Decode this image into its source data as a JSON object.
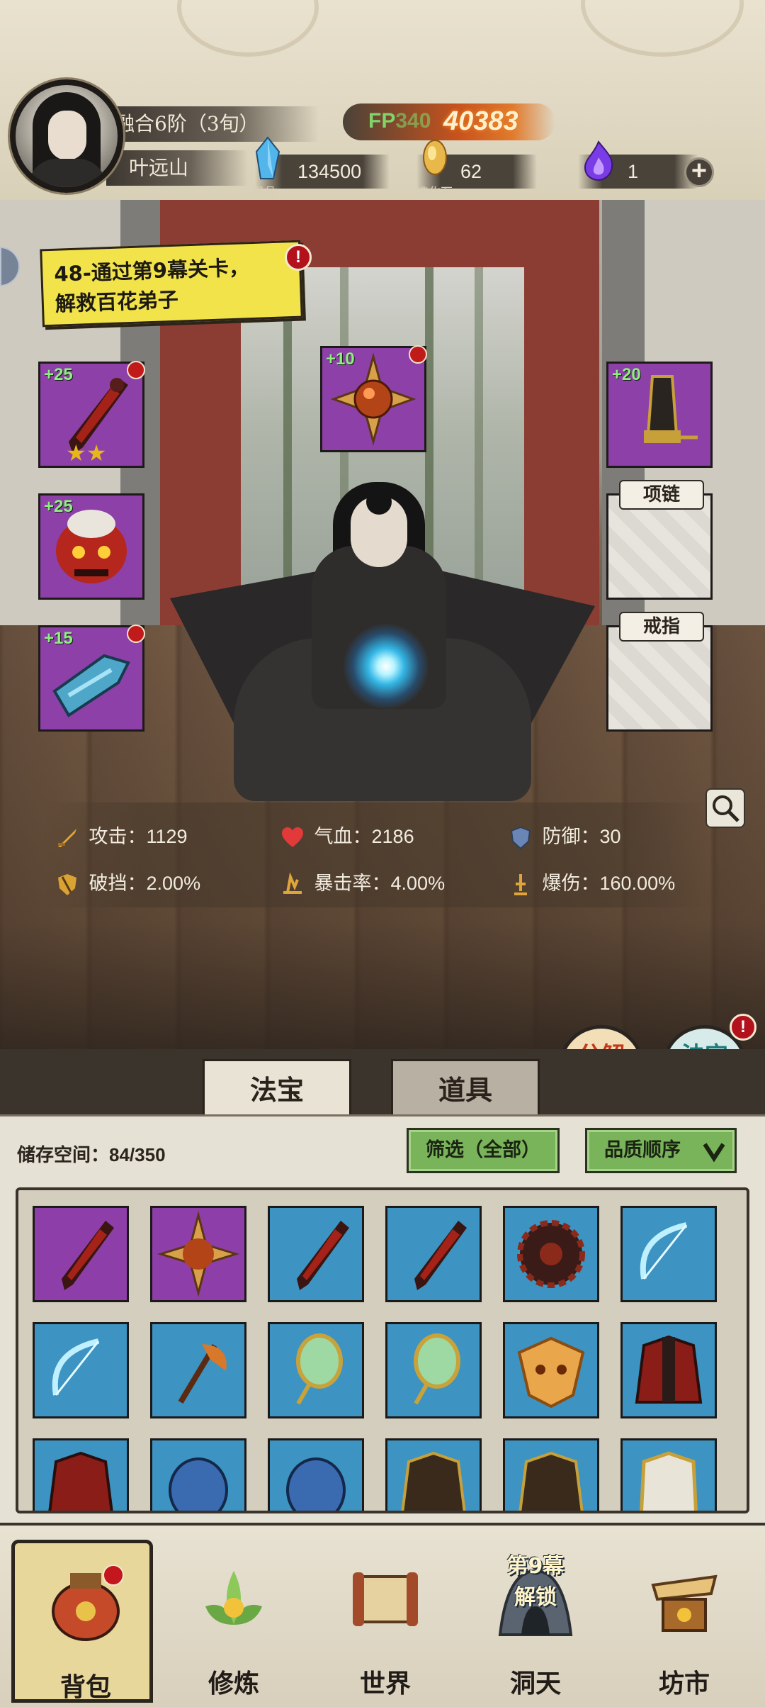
{
  "player": {
    "realm": "融合6阶（3旬）",
    "name": "叶远山",
    "power_label": "FP",
    "power_label_tail": "340",
    "power_value": "40383"
  },
  "resources": [
    {
      "name": "灵晶",
      "value": "134500",
      "icon": "blue-crystal-icon"
    },
    {
      "name": "造化石",
      "value": "62",
      "icon": "golden-stone-icon"
    },
    {
      "name": "",
      "value": "1",
      "icon": "purple-flame-icon"
    }
  ],
  "quest": {
    "line1": "48-通过第9幕关卡，",
    "line2": "解救百花弟子",
    "alert": "!"
  },
  "equipment": {
    "weapon": {
      "level": "+25",
      "stars": "★★"
    },
    "head": {
      "level": "+10"
    },
    "belt": {
      "level": "+20"
    },
    "armor": {
      "level": "+25"
    },
    "boots": {
      "level": "+15"
    },
    "necklace": {
      "label": "项链"
    },
    "ring": {
      "label": "戒指"
    }
  },
  "stats": {
    "attack": "攻击：1129",
    "hp": "气血：2186",
    "defense": "防御：30",
    "pierce": "破挡：2.00%",
    "crit_rate": "暴击率：4.00%",
    "crit_dmg": "爆伤：160.00%"
  },
  "actions": {
    "decompose": [
      "分解",
      "再造"
    ],
    "synthesize": [
      "法宝",
      "合成"
    ],
    "alert": "!"
  },
  "tabs": {
    "treasure": "法宝",
    "items": "道具"
  },
  "inventory": {
    "storage": "储存空间：84/350",
    "filter": "筛选（全部）",
    "sort": "品质顺序",
    "sort_icon": "chevron-down-icon",
    "colors": {
      "purple": "#8d3ea8",
      "blue": "#3d93c1"
    }
  },
  "nav": {
    "bag": "背包",
    "cultivate": "修炼",
    "world": "世界",
    "cave_line1": "第9幕",
    "cave_line2": "解锁",
    "cave": "洞天",
    "market": "坊市"
  }
}
